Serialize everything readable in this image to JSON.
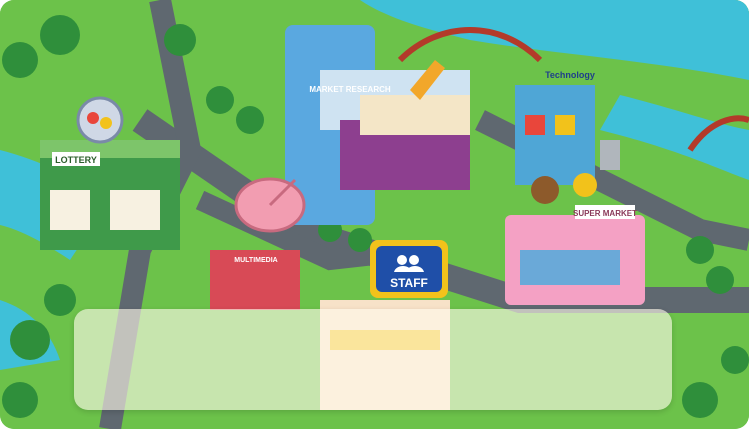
{
  "buildings": {
    "lottery": {
      "label": "LOTTERY"
    },
    "market_research": {
      "label": "MARKET RESEARCH"
    },
    "technology": {
      "label": "Technology"
    },
    "multimedia": {
      "label": "MULTIMEDIA"
    },
    "supermarket": {
      "label": "SUPER MARKET"
    }
  },
  "staff_button": {
    "label": "STAFF"
  },
  "overlay": {
    "text": ""
  },
  "colors": {
    "grass": "#6cc24a",
    "water": "#3fc0d8",
    "road": "#5f6870",
    "staff_sign": "#1f4fa8",
    "staff_frame": "#f2c21b"
  }
}
